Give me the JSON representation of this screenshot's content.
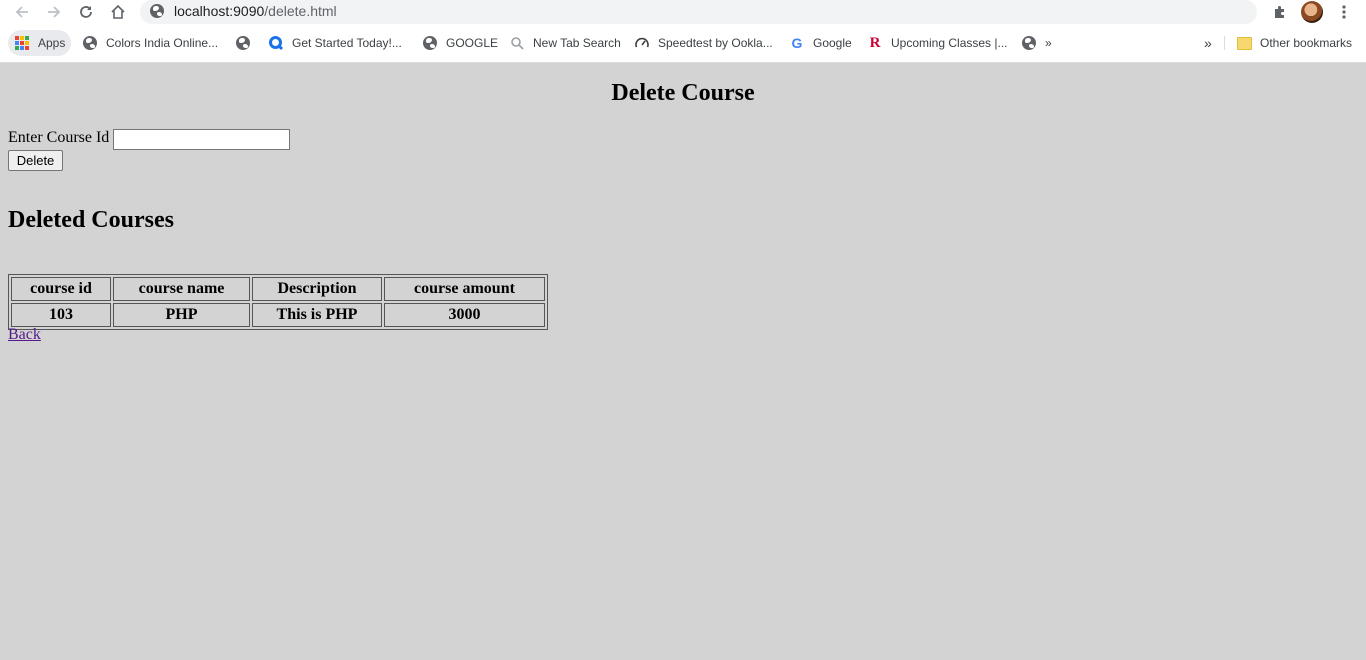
{
  "browser": {
    "url_host": "localhost:9090",
    "url_path": "/delete.html",
    "bookmarks": [
      {
        "label": "Apps",
        "icon": "apps-grid-icon"
      },
      {
        "label": "Colors India Online...",
        "icon": "globe-icon"
      },
      {
        "label": "",
        "icon": "globe-icon"
      },
      {
        "label": "Get Started Today!...",
        "icon": "q-logo-icon"
      },
      {
        "label": "GOOGLE",
        "icon": "globe-icon"
      },
      {
        "label": "New Tab Search",
        "icon": "search-icon"
      },
      {
        "label": "Speedtest by Ookla...",
        "icon": "speedometer-icon"
      },
      {
        "label": "Google",
        "icon": "google-g-icon"
      },
      {
        "label": "Upcoming Classes |...",
        "icon": "rutgers-r-icon"
      },
      {
        "label": "»",
        "icon": "globe-icon"
      }
    ],
    "overflow_label": "»",
    "other_bookmarks_label": "Other bookmarks"
  },
  "page": {
    "title": "Delete Course",
    "course_id_label": "Enter Course Id",
    "course_id_value": "",
    "delete_button_label": "Delete",
    "deleted_heading": "Deleted Courses",
    "table": {
      "headers": [
        "course id",
        "course name",
        "Description",
        "course amount"
      ],
      "rows": [
        [
          "103",
          "PHP",
          "This is PHP",
          "3000"
        ]
      ]
    },
    "back_link": "Back"
  },
  "colors": {
    "page_background": "#d3d3d3",
    "visited_link": "#551a8b"
  }
}
